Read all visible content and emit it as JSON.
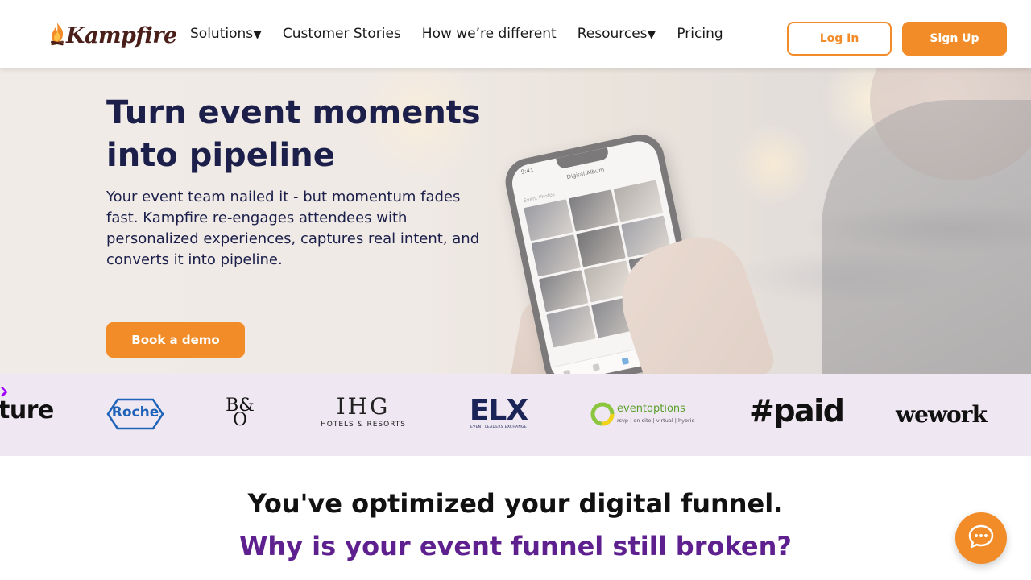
{
  "header": {
    "logo_text": "Kampfire",
    "nav": [
      {
        "label": "Solutions",
        "caret": "▼"
      },
      {
        "label": "Customer Stories"
      },
      {
        "label": "How we’re different"
      },
      {
        "label": "Resources",
        "caret": "▼"
      },
      {
        "label": "Pricing"
      }
    ],
    "login_label": "Log In",
    "signup_label": "Sign Up"
  },
  "hero": {
    "title": "Turn event moments into pipeline",
    "body": "Your event team nailed it - but momentum fades fast. Kampfire re-engages attendees with personalized experiences, captures real intent, and converts it into pipeline.",
    "cta_label": "Book a demo",
    "phone": {
      "time": "9:41",
      "title": "Digital Album",
      "subtitle": "Event Photos"
    }
  },
  "logos": {
    "items": [
      {
        "name": "accenture",
        "text": "ture"
      },
      {
        "name": "roche",
        "text": "Roche"
      },
      {
        "name": "bang-olufsen",
        "text_top": "B&",
        "text_bottom": "O"
      },
      {
        "name": "ihg",
        "text": "IHG",
        "subtext": "HOTELS & RESORTS"
      },
      {
        "name": "elx",
        "text": "ELX",
        "subtext": "EVENT LEADERS EXCHANGE"
      },
      {
        "name": "eventoptions",
        "text": "eventoptions",
        "subtext": "rsvp | on-site | virtual | hybrid"
      },
      {
        "name": "paid",
        "text": "#paid"
      },
      {
        "name": "wework",
        "text": "wework"
      }
    ]
  },
  "section": {
    "title": "You've optimized your digital funnel.",
    "subtitle": "Why is your event funnel still broken?"
  },
  "colors": {
    "accent": "#f28c28",
    "hero_text": "#1b1f4a",
    "subtitle_purple": "#5e1f8f",
    "logo_strip_bg": "#efe7f2"
  },
  "icons": {
    "chat": "chat-bubble-icon",
    "logo_flame": "flame-icon"
  }
}
